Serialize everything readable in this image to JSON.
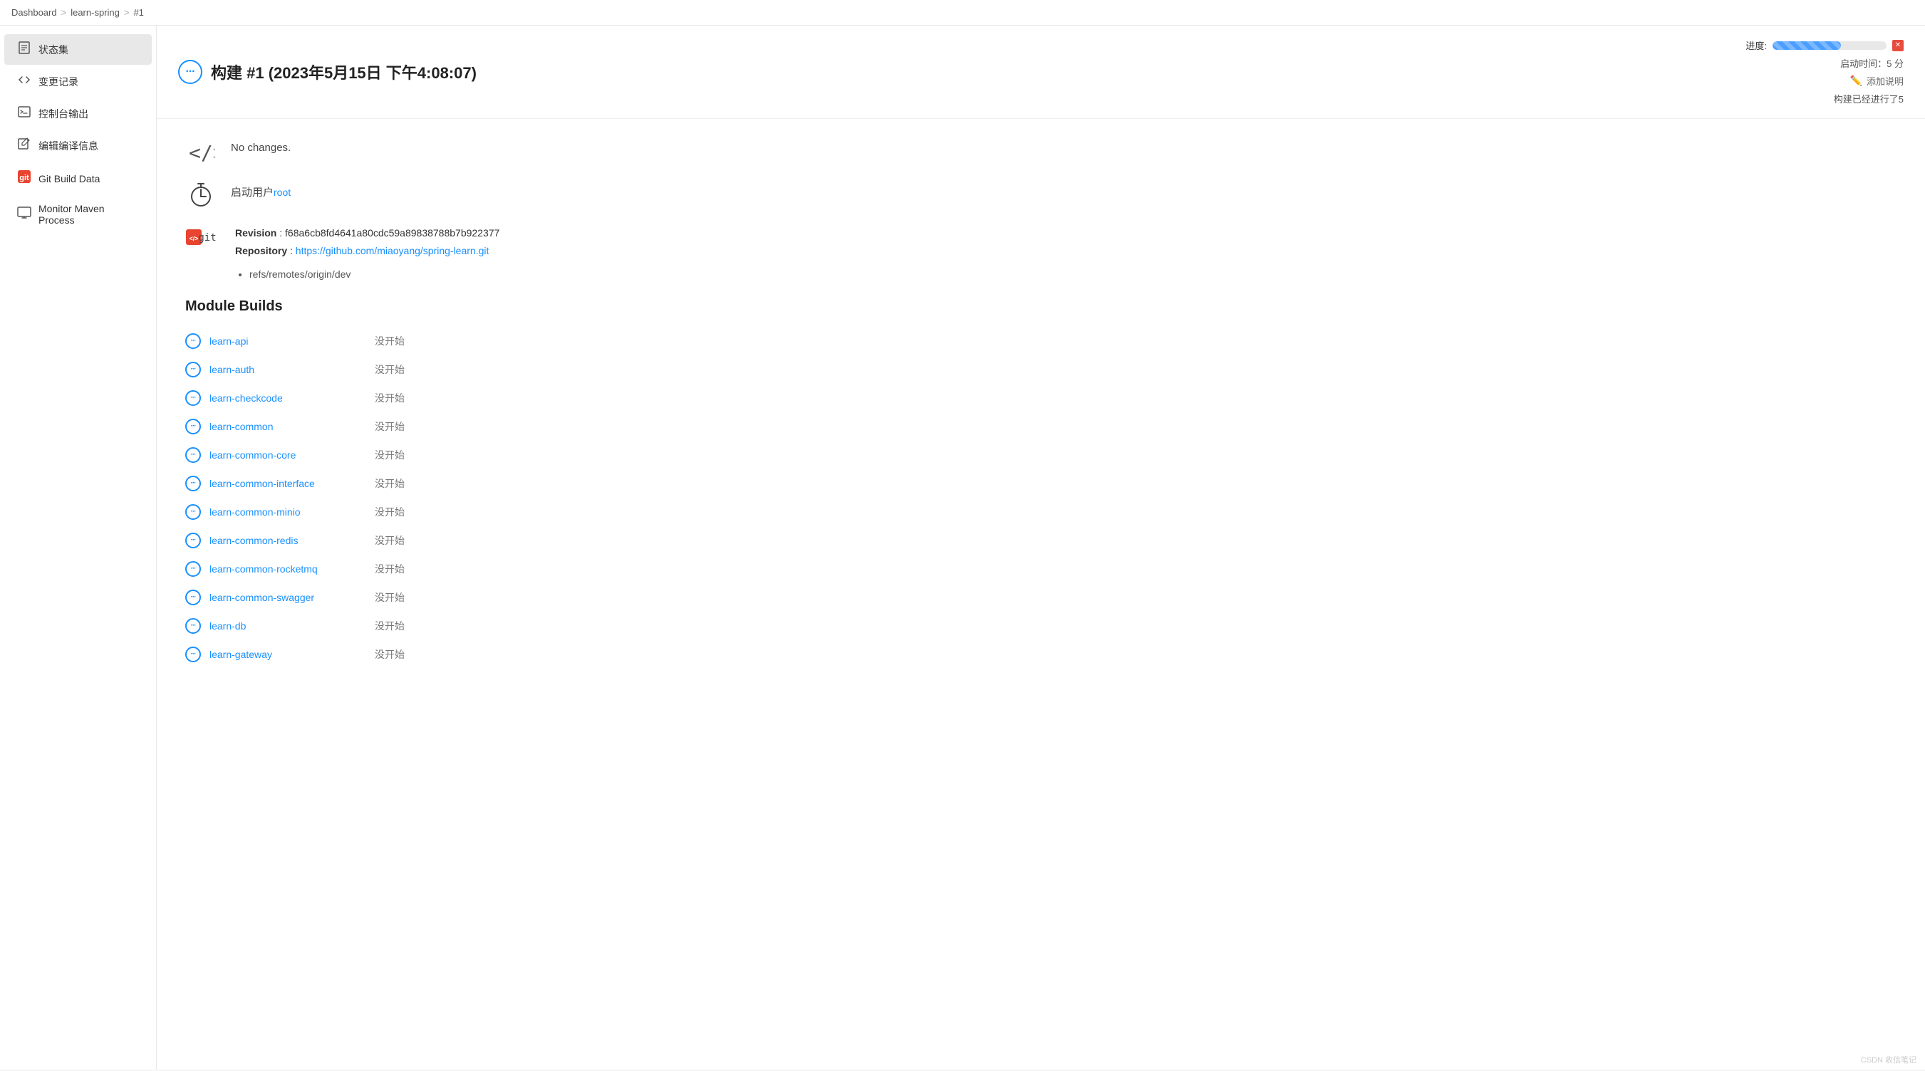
{
  "breadcrumb": {
    "items": [
      "Dashboard",
      "learn-spring",
      "#1"
    ],
    "separators": [
      ">",
      ">"
    ]
  },
  "sidebar": {
    "items": [
      {
        "id": "status",
        "label": "状态集",
        "icon": "doc",
        "active": true
      },
      {
        "id": "changes",
        "label": "变更记录",
        "icon": "code"
      },
      {
        "id": "console",
        "label": "控制台输出",
        "icon": "terminal"
      },
      {
        "id": "compile",
        "label": "编辑编译信息",
        "icon": "edit"
      },
      {
        "id": "git",
        "label": "Git Build Data",
        "icon": "git"
      },
      {
        "id": "monitor",
        "label": "Monitor Maven Process",
        "icon": "monitor"
      }
    ]
  },
  "build": {
    "title": "构建 #1 (2023年5月15日 下午4:08:07)",
    "status": "running",
    "progress_label": "进度:",
    "progress_percent": 60,
    "start_time_label": "启动时间：5 分",
    "running_label": "构建已经进行了5",
    "add_note_label": "添加说明",
    "no_changes": "No changes.",
    "started_by_prefix": "启动用户",
    "started_by_user": "root",
    "revision_label": "Revision",
    "revision_hash": "f68a6cb8fd4641a80cdc59a89838788b7b922377",
    "repository_label": "Repository",
    "repository_url": "https://github.com/miaoyang/spring-learn.git",
    "refs": [
      "refs/remotes/origin/dev"
    ]
  },
  "module_builds": {
    "title": "Module Builds",
    "modules": [
      {
        "name": "learn-api",
        "status": "没开始"
      },
      {
        "name": "learn-auth",
        "status": "没开始"
      },
      {
        "name": "learn-checkcode",
        "status": "没开始"
      },
      {
        "name": "learn-common",
        "status": "没开始"
      },
      {
        "name": "learn-common-core",
        "status": "没开始"
      },
      {
        "name": "learn-common-interface",
        "status": "没开始"
      },
      {
        "name": "learn-common-minio",
        "status": "没开始"
      },
      {
        "name": "learn-common-redis",
        "status": "没开始"
      },
      {
        "name": "learn-common-rocketmq",
        "status": "没开始"
      },
      {
        "name": "learn-common-swagger",
        "status": "没开始"
      },
      {
        "name": "learn-db",
        "status": "没开始"
      },
      {
        "name": "learn-gateway",
        "status": "没开始"
      }
    ]
  },
  "watermark": "CSDN 收信笔记"
}
